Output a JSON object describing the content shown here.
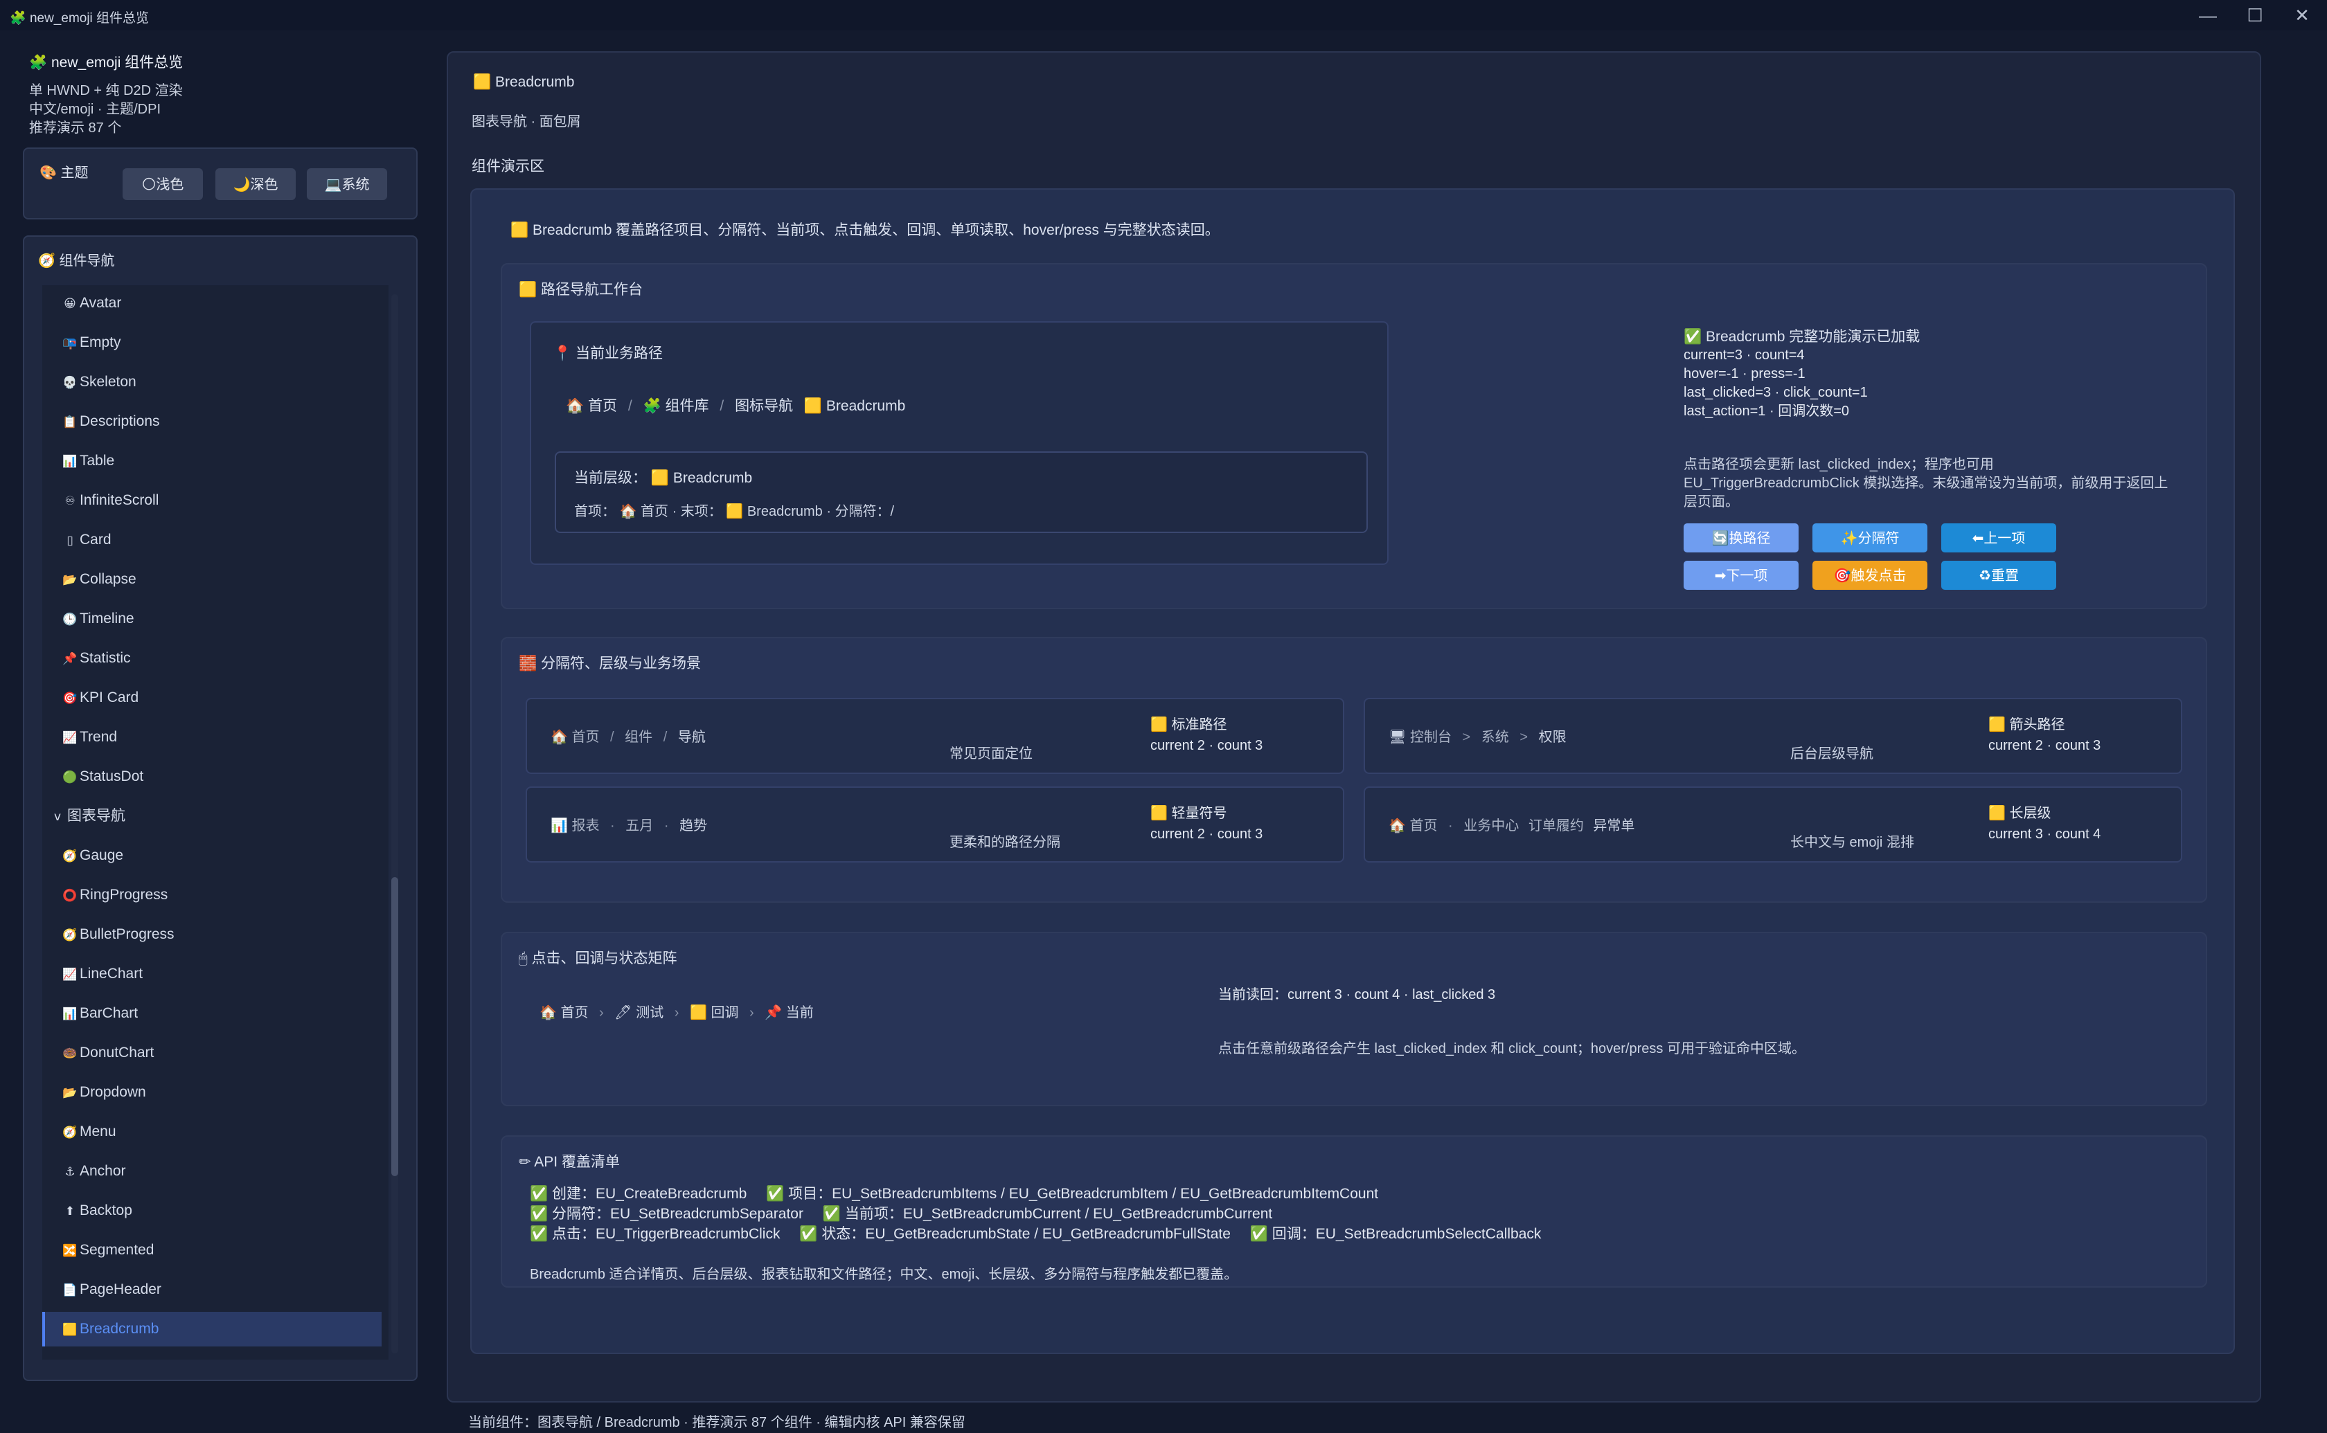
{
  "window": {
    "title": "new_emoji 组件总览",
    "app_icon": "puzzle-icon",
    "controls": [
      "—",
      "☐",
      "✕"
    ]
  },
  "sidebar": {
    "app_title": "new_emoji 组件总览",
    "info": [
      "单 HWND + 纯 D2D 渲染",
      "中文/emoji · 主题/DPI",
      "推荐演示 87 个"
    ],
    "theme": {
      "label": "主题",
      "buttons": [
        {
          "icon": "🌕",
          "label": "浅色"
        },
        {
          "icon": "🌙",
          "label": "深色"
        },
        {
          "icon": "💻",
          "label": "系统"
        }
      ]
    },
    "nav": {
      "title": "组件导航",
      "items": [
        {
          "icon": "😀",
          "label": "Avatar"
        },
        {
          "icon": "📭",
          "label": "Empty"
        },
        {
          "icon": "💀",
          "label": "Skeleton"
        },
        {
          "icon": "📋",
          "label": "Descriptions"
        },
        {
          "icon": "📊",
          "label": "Table"
        },
        {
          "icon": "♾",
          "label": "InfiniteScroll"
        },
        {
          "icon": "▯",
          "label": "Card"
        },
        {
          "icon": "📂",
          "label": "Collapse"
        },
        {
          "icon": "🕒",
          "label": "Timeline"
        },
        {
          "icon": "📌",
          "label": "Statistic"
        },
        {
          "icon": "🎯",
          "label": "KPI Card"
        },
        {
          "icon": "📈",
          "label": "Trend"
        },
        {
          "icon": "🟢",
          "label": "StatusDot"
        },
        {
          "icon": "v",
          "label": "图表导航"
        },
        {
          "icon": "🧭",
          "label": "Gauge"
        },
        {
          "icon": "⭕",
          "label": "RingProgress"
        },
        {
          "icon": "🧭",
          "label": "BulletProgress"
        },
        {
          "icon": "📈",
          "label": "LineChart"
        },
        {
          "icon": "📊",
          "label": "BarChart"
        },
        {
          "icon": "🍩",
          "label": "DonutChart"
        },
        {
          "icon": "📂",
          "label": "Dropdown"
        },
        {
          "icon": "🧭",
          "label": "Menu"
        },
        {
          "icon": "⚓",
          "label": "Anchor"
        },
        {
          "icon": "⬆",
          "label": "Backtop"
        },
        {
          "icon": "🔀",
          "label": "Segmented"
        },
        {
          "icon": "📄",
          "label": "PageHeader"
        },
        {
          "icon": "🟨",
          "label": "Breadcrumb"
        }
      ]
    }
  },
  "main": {
    "title": "Breadcrumb",
    "subtitle": "图表导航 · 面包屑",
    "demo_title": "组件演示区",
    "intro": "Breadcrumb 覆盖路径项目、分隔符、当前项、点击触发、回调、单项读取、hover/press 与完整状态读回。",
    "workbench": {
      "title": "路径导航工作台",
      "path_title": "当前业务路径",
      "crumbs": [
        "首页",
        "组件库",
        "图标导航",
        "Breadcrumb"
      ],
      "crumb_icons": [
        "🏠",
        "🧩",
        "",
        "🟨"
      ],
      "level_label": "当前层级：",
      "level_value": "Breadcrumb",
      "detail": [
        "首项：",
        "首页",
        " · 末项：",
        "Breadcrumb",
        " · 分隔符：/"
      ],
      "status_title": "Breadcrumb 完整功能演示已加载",
      "status_lines": [
        "current=3 · count=4",
        "hover=-1 · press=-1",
        "last_clicked=3 · click_count=1",
        "last_action=1 · 回调次数=0"
      ],
      "hint_lines": [
        "点击路径项会更新 last_clicked_index；程序也可用",
        "EU_TriggerBreadcrumbClick 模拟选择。末级通常设为当前项，前级用于返回上",
        "层页面。"
      ],
      "buttons": [
        {
          "icon": "🔄",
          "label": "换路径"
        },
        {
          "icon": "✨",
          "label": "分隔符"
        },
        {
          "icon": "⬅",
          "label": "上一项"
        },
        {
          "icon": "➡",
          "label": "下一项"
        },
        {
          "icon": "🎯",
          "label": "触发点击"
        },
        {
          "icon": "♻",
          "label": "重置"
        }
      ]
    },
    "separators": {
      "title": "分隔符、层级与业务场景",
      "cards": [
        {
          "crumbs": [
            "首页",
            "组件",
            "导航"
          ],
          "sep": "/",
          "caption": "常见页面定位",
          "tag": "标准路径",
          "stats": "current 2 · count 3"
        },
        {
          "crumbs": [
            "控制台",
            "系统",
            "权限"
          ],
          "sep": ">",
          "caption": "后台层级导航",
          "tag": "箭头路径",
          "stats": "current 2 · count 3"
        },
        {
          "crumbs": [
            "报表",
            "五月",
            "趋势"
          ],
          "sep": "·",
          "caption": "更柔和的路径分隔",
          "tag": "轻量符号",
          "stats": "current 2 · count 3"
        },
        {
          "crumbs": [
            "首页",
            "业务中心",
            "订单履约",
            "异常单"
          ],
          "sep": "·",
          "caption": "长中文与 emoji 混排",
          "tag": "长层级",
          "stats": "current 3 · count 4"
        }
      ]
    },
    "matrix": {
      "title": "点击、回调与状态矩阵",
      "crumbs": [
        "首页",
        "测试",
        "回调",
        "当前"
      ],
      "readback": "当前读回：current 3 · count 4 · last_clicked 3",
      "hint": "点击任意前级路径会产生 last_clicked_index 和 click_count；hover/press 可用于验证命中区域。"
    },
    "api": {
      "title": "API 覆盖清单",
      "lines": [
        [
          "创建：EU_CreateBreadcrumb",
          "项目：EU_SetBreadcrumbItems / EU_GetBreadcrumbItem / EU_GetBreadcrumbItemCount"
        ],
        [
          "分隔符：EU_SetBreadcrumbSeparator",
          "当前项：EU_SetBreadcrumbCurrent / EU_GetBreadcrumbCurrent"
        ],
        [
          "点击：EU_TriggerBreadcrumbClick",
          "状态：EU_GetBreadcrumbState / EU_GetBreadcrumbFullState",
          "回调：EU_SetBreadcrumbSelectCallback"
        ]
      ],
      "summary": "Breadcrumb 适合详情页、后台层级、报表钻取和文件路径；中文、emoji、长层级、多分隔符与程序触发都已覆盖。"
    }
  },
  "footer": "当前组件：图表导航 / Breadcrumb · 推荐演示 87 个组件 · 编辑内核 API 兼容保留"
}
